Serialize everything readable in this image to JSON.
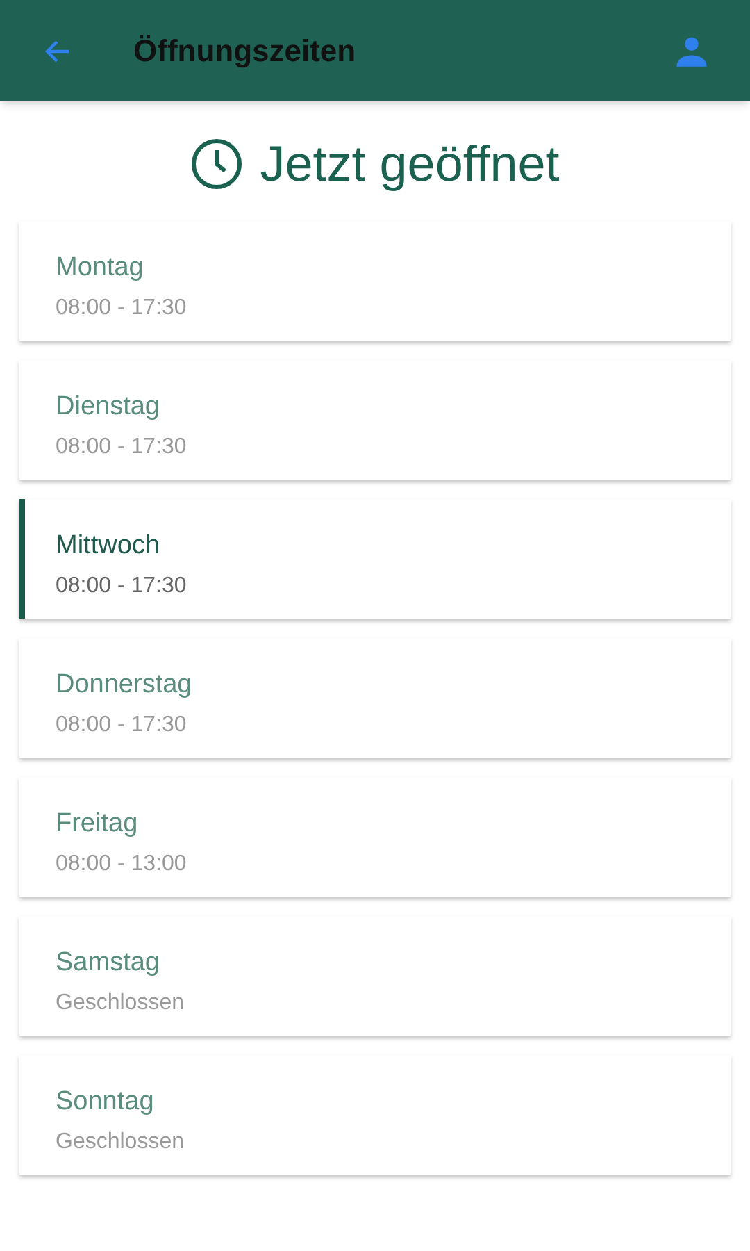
{
  "header": {
    "title": "Öffnungszeiten"
  },
  "status": {
    "text": "Jetzt geöffnet"
  },
  "days": [
    {
      "name": "Montag",
      "hours": "08:00 - 17:30",
      "selected": false
    },
    {
      "name": "Dienstag",
      "hours": "08:00 - 17:30",
      "selected": false
    },
    {
      "name": "Mittwoch",
      "hours": "08:00 - 17:30",
      "selected": true
    },
    {
      "name": "Donnerstag",
      "hours": "08:00 - 17:30",
      "selected": false
    },
    {
      "name": "Freitag",
      "hours": "08:00 - 13:00",
      "selected": false
    },
    {
      "name": "Samstag",
      "hours": "Geschlossen",
      "selected": false
    },
    {
      "name": "Sonntag",
      "hours": "Geschlossen",
      "selected": false
    }
  ]
}
